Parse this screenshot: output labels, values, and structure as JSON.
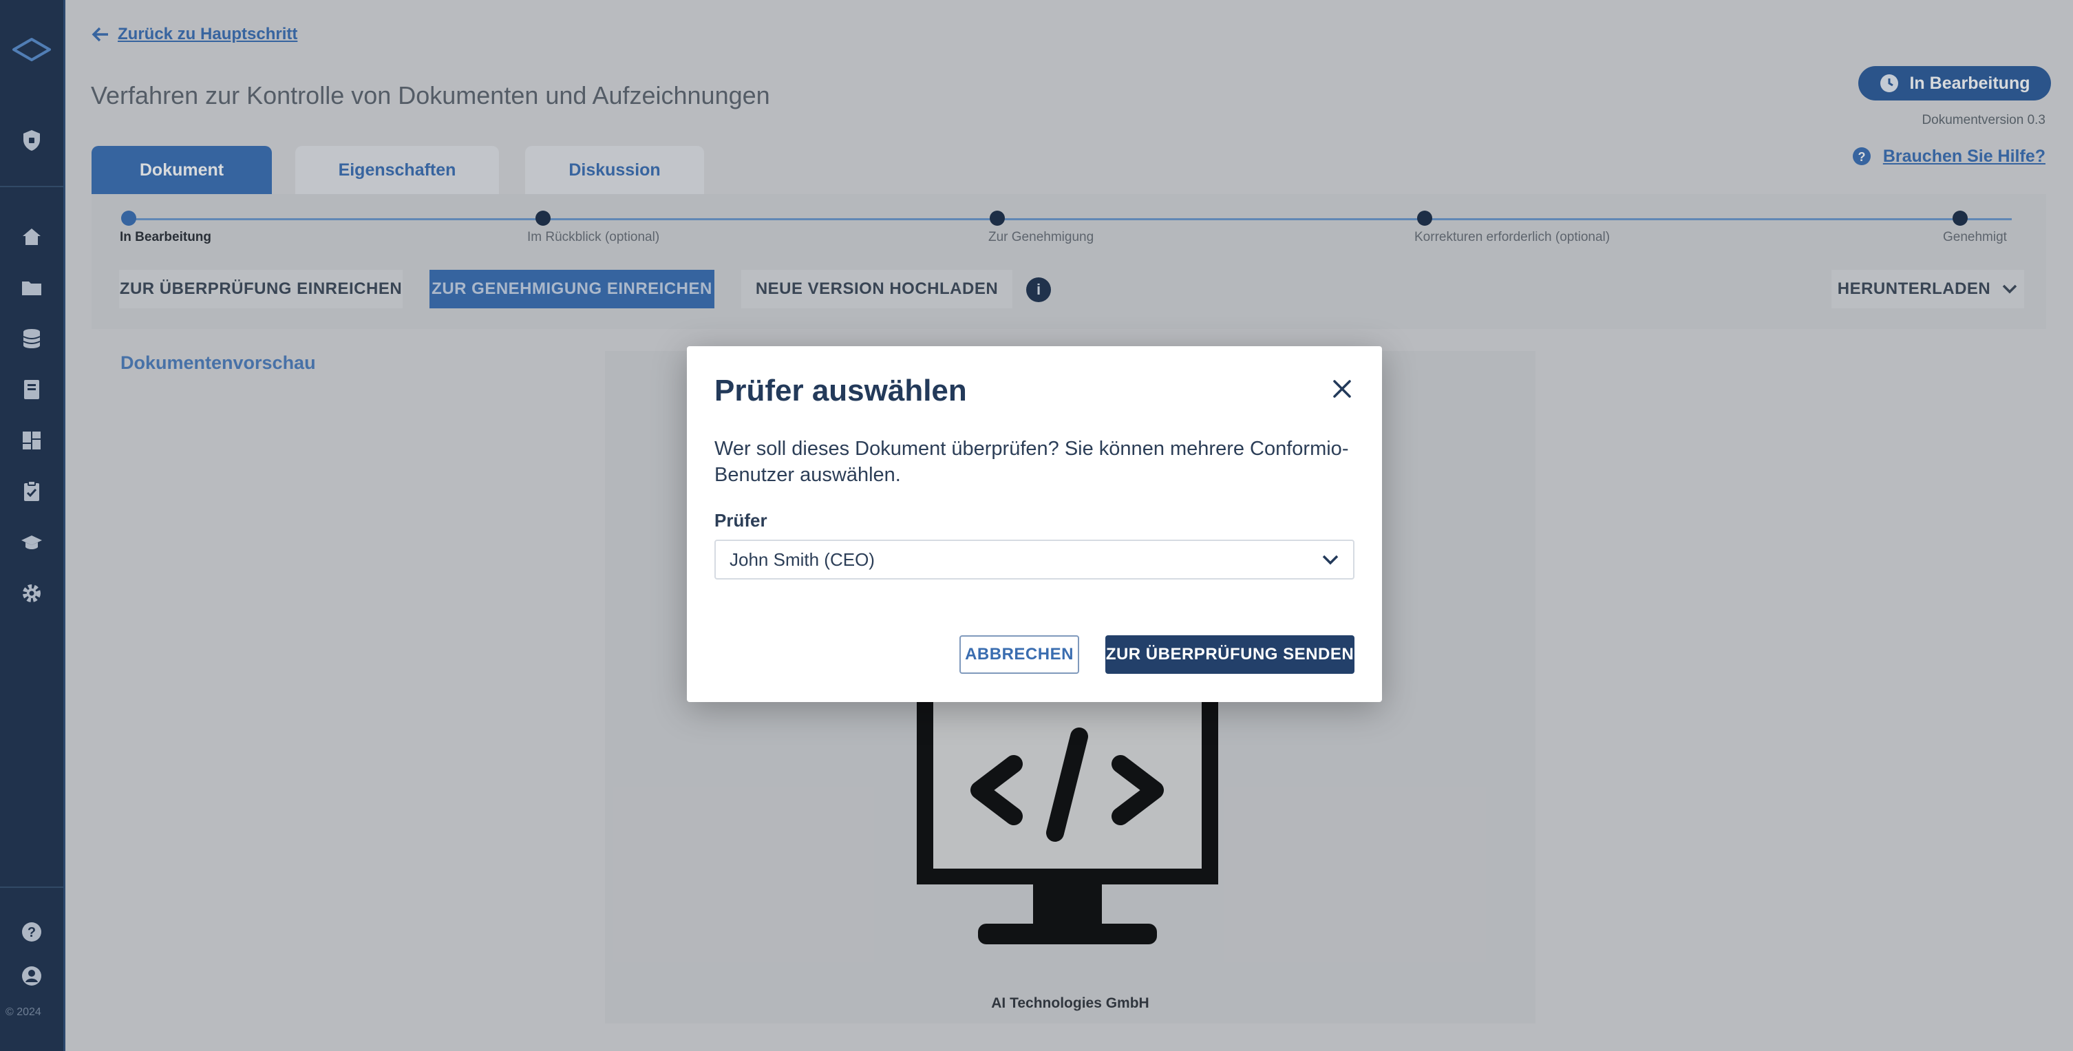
{
  "sidebar": {
    "year": "© 2024",
    "icons": [
      "logo-icon",
      "shield-icon",
      "home-icon",
      "folder-icon",
      "database-icon",
      "book-icon",
      "dashboard-icon",
      "clipboard-icon",
      "graduation-icon",
      "gear-icon",
      "help-icon",
      "user-icon"
    ]
  },
  "header": {
    "back_link": "Zurück zu Hauptschritt",
    "title": "Verfahren zur Kontrolle von Dokumenten und Aufzeichnungen",
    "status": "In Bearbeitung",
    "doc_version": "Dokumentversion 0.3",
    "help": "Brauchen Sie Hilfe?"
  },
  "tabs": [
    {
      "label": "Dokument",
      "active": true
    },
    {
      "label": "Eigenschaften",
      "active": false
    },
    {
      "label": "Diskussion",
      "active": false
    }
  ],
  "workflow": {
    "steps": [
      "In Bearbeitung",
      "Im Rückblick (optional)",
      "Zur Genehmigung",
      "Korrekturen erforderlich (optional)",
      "Genehmigt"
    ],
    "actions": {
      "submit_review": "ZUR ÜBERPRÜFUNG EINREICHEN",
      "submit_approval": "ZUR GENEHMIGUNG EINREICHEN",
      "upload_version": "NEUE VERSION HOCHLADEN",
      "download": "HERUNTERLADEN"
    }
  },
  "preview": {
    "label": "Dokumentenvorschau",
    "company": "AI Technologies GmbH"
  },
  "modal": {
    "title": "Prüfer auswählen",
    "description": "Wer soll dieses Dokument überprüfen? Sie können mehrere Conformio-Benutzer auswählen.",
    "field_label": "Prüfer",
    "selected_reviewer": "John Smith (CEO)",
    "cancel": "ABBRECHEN",
    "send": "ZUR ÜBERPRÜFUNG SENDEN"
  },
  "colors": {
    "sidebar": "#1f3350",
    "accent": "#3a70b5",
    "modal_title": "#233a5a",
    "primary_button": "#23406a"
  }
}
